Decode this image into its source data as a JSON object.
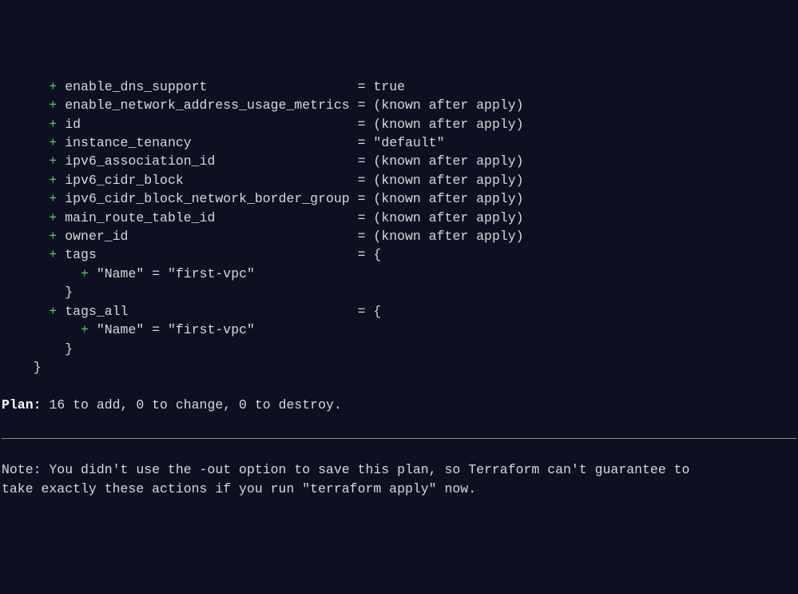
{
  "attrs": [
    {
      "key": "enable_dns_support",
      "val": "true",
      "pad": 40
    },
    {
      "key": "enable_network_address_usage_metrics",
      "val": "(known after apply)",
      "pad": 40
    },
    {
      "key": "id",
      "val": "(known after apply)",
      "pad": 40
    },
    {
      "key": "instance_tenancy",
      "val": "\"default\"",
      "pad": 40
    },
    {
      "key": "ipv6_association_id",
      "val": "(known after apply)",
      "pad": 40
    },
    {
      "key": "ipv6_cidr_block",
      "val": "(known after apply)",
      "pad": 40
    },
    {
      "key": "ipv6_cidr_block_network_border_group",
      "val": "(known after apply)",
      "pad": 40
    },
    {
      "key": "main_route_table_id",
      "val": "(known after apply)",
      "pad": 40
    },
    {
      "key": "owner_id",
      "val": "(known after apply)",
      "pad": 40
    }
  ],
  "tags_key": "tags",
  "tags_all_key": "tags_all",
  "tag_name_key": "\"Name\"",
  "tag_name_val": "\"first-vpc\"",
  "open_brace": "{",
  "close_brace": "}",
  "eq": "=",
  "plan_label": "Plan:",
  "plan_text": " 16 to add, 0 to change, 0 to destroy.",
  "note_line1": "Note: You didn't use the -out option to save this plan, so Terraform can't guarantee to",
  "note_line2": "take exactly these actions if you run \"terraform apply\" now."
}
